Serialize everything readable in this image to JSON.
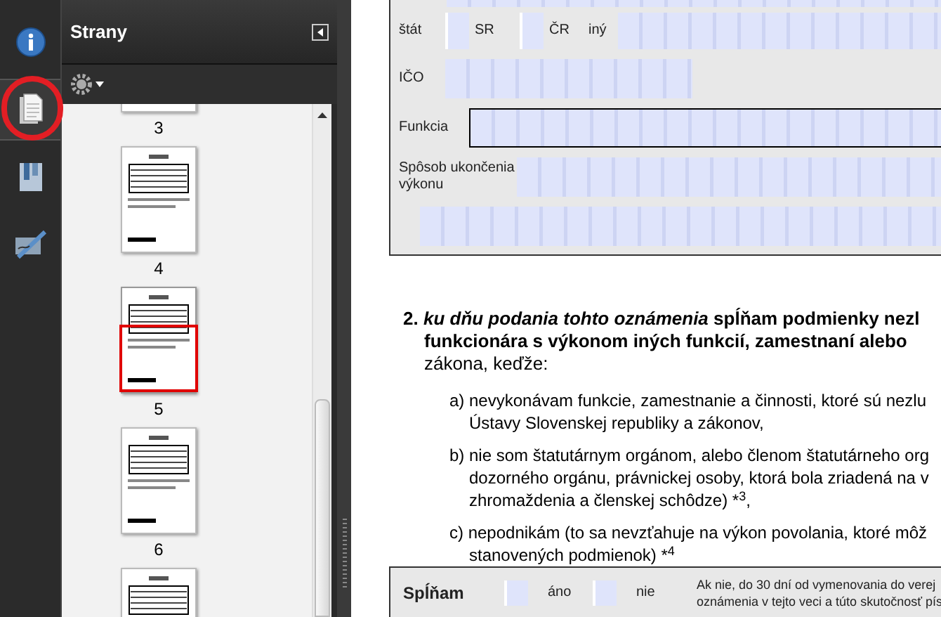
{
  "sidebar_tools": [
    {
      "kind": "info",
      "selected": false
    },
    {
      "kind": "pages",
      "selected": true
    },
    {
      "kind": "bookmarks",
      "selected": false
    },
    {
      "kind": "signatures",
      "selected": false
    }
  ],
  "panel": {
    "title": "Strany"
  },
  "thumbnails": [
    {
      "label": "3",
      "selected": false
    },
    {
      "label": "4",
      "selected": false
    },
    {
      "label": "5",
      "selected": true
    },
    {
      "label": "6",
      "selected": false
    },
    {
      "selected": false
    }
  ],
  "form": {
    "state_label": "štát",
    "state_options": [
      {
        "label": "SR",
        "checked": false
      },
      {
        "label": "ČR",
        "checked": false
      }
    ],
    "other_label": "iný",
    "fields": [
      {
        "label": "IČO",
        "focused": false
      },
      {
        "label": "Funkcia",
        "focused": true
      },
      {
        "label": "Spôsob ukončenia výkonu",
        "focused": false
      }
    ]
  },
  "section": {
    "number": "2.",
    "lead": "ku dňu podania tohto oznámenia",
    "lines": [
      "spĺňam podmienky nezl",
      "funkcionára s výkonom iných funkcií, zamestnaní alebo"
    ],
    "tail": "zákona, keďže:",
    "items": [
      {
        "lines": [
          "a) nevykonávam funkcie, zamestnanie a činnosti, ktoré sú nezlu",
          "Ústavy Slovenskej republiky a zákonov,"
        ]
      },
      {
        "lines": [
          "b) nie som štatutárnym orgánom, alebo členom štatutárneho org",
          "dozorného orgánu, právnickej osoby, ktorá bola zriadená na v",
          "zhromaždenia a členskej schôdze) *$^{3}$,"
        ]
      },
      {
        "lines": [
          "c) nepodnikám (to sa nevzťahuje na výkon povolania, ktoré môž",
          "stanovených podmienok) *$^{4}$"
        ]
      }
    ]
  },
  "compliance": {
    "label": "Spĺňam",
    "options": [
      {
        "label": "áno",
        "checked": false
      },
      {
        "label": "nie",
        "checked": false
      }
    ],
    "note": [
      "Ak nie, do 30 dní od vymenovania do verej",
      "oznámenia v tejto veci a túto skutočnosť pís"
    ]
  }
}
